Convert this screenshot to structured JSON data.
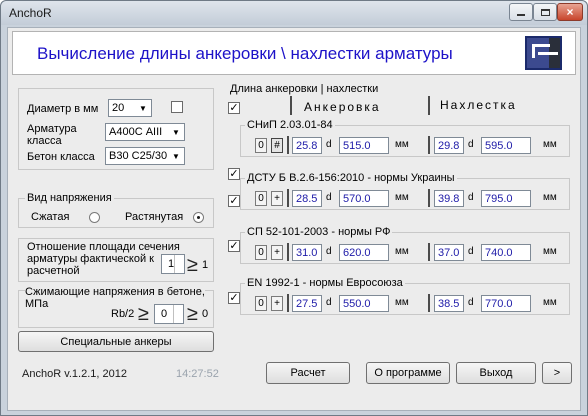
{
  "window": {
    "app_title": "AnchoR",
    "main_title": "Вычисление длины анкеровки \\ нахлестки арматуры",
    "min_symbol": "",
    "max_symbol": "",
    "close_symbol": "×"
  },
  "left": {
    "diameter_label": "Диаметр в мм",
    "diameter_value": "20",
    "rebar_class_label": "Арматура класса",
    "rebar_class_value": "А400С AIII",
    "concrete_class_label": "Бетон класса",
    "concrete_class_value": "B30  C25/30",
    "stress_group_title": "Вид напряжения",
    "compressed_label": "Сжатая",
    "tensile_label": "Растянутая",
    "stress_selected": "tensile",
    "ratio_group_text": "Отношение площади сечения арматуры фактической к расчетной",
    "ratio_value": "1",
    "ratio_ge": "≥",
    "ratio_min": "1",
    "compress_group_text": "Сжимающие напряжения в бетоне, МПа",
    "compress_formula": "Rb/2",
    "compress_ge1": "≥",
    "compress_value": "0",
    "compress_ge2": "≥",
    "compress_min": "0",
    "special_button": "Специальные анкеры"
  },
  "right": {
    "group_title": "Длина анкеровки | нахлестки",
    "col_anchor": "Анкеровка",
    "col_lap": "Нахлестка",
    "unit_d": "d",
    "unit_mm": "мм",
    "norms": [
      {
        "name": "СНиП 2.03.01-84",
        "btn0": "0",
        "btn1": "#",
        "anchor_d": "25.8",
        "anchor_mm": "515.0",
        "lap_d": "29.8",
        "lap_mm": "595.0"
      },
      {
        "name": "ДСТУ Б В.2.6-156:2010 - нормы Украины",
        "btn0": "0",
        "btn1": "+",
        "anchor_d": "28.5",
        "anchor_mm": "570.0",
        "lap_d": "39.8",
        "lap_mm": "795.0"
      },
      {
        "name": "СП 52-101-2003 - нормы РФ",
        "btn0": "0",
        "btn1": "+",
        "anchor_d": "31.0",
        "anchor_mm": "620.0",
        "lap_d": "37.0",
        "lap_mm": "740.0"
      },
      {
        "name": "EN 1992-1 - нормы Евросоюза",
        "btn0": "0",
        "btn1": "+",
        "anchor_d": "27.5",
        "anchor_mm": "550.0",
        "lap_d": "38.5",
        "lap_mm": "770.0"
      }
    ]
  },
  "footer": {
    "version": "AnchoR v.1.2.1, 2012",
    "time": "14:27:52",
    "calc_button": "Расчет",
    "about_button": "О программе",
    "exit_button": "Выход",
    "next_button": ">"
  }
}
